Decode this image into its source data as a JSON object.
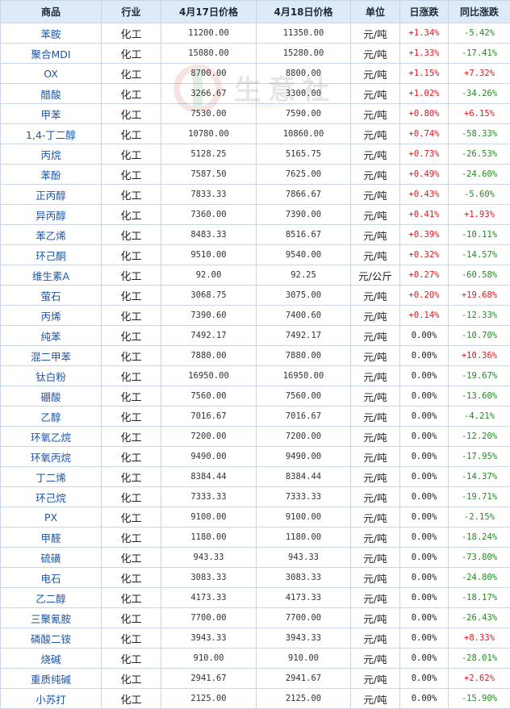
{
  "headers": [
    "商品",
    "行业",
    "4月17日价格",
    "4月18日价格",
    "单位",
    "日涨跌",
    "同比涨跌"
  ],
  "watermark": {
    "brand": "生意社",
    "site": "100ppi.com"
  },
  "colors": {
    "up": "#e0171f",
    "down": "#238a1f",
    "header_bg": "#dfeaf7",
    "link": "#1d55a8",
    "border": "#c7d5e6"
  },
  "rows": [
    {
      "name": "苯胺",
      "industry": "化工",
      "p1": "11200.00",
      "p2": "11350.00",
      "unit": "元/吨",
      "day": "+1.34%",
      "yoy": "-5.42%"
    },
    {
      "name": "聚合MDI",
      "industry": "化工",
      "p1": "15080.00",
      "p2": "15280.00",
      "unit": "元/吨",
      "day": "+1.33%",
      "yoy": "-17.41%"
    },
    {
      "name": "OX",
      "industry": "化工",
      "p1": "8700.00",
      "p2": "8800.00",
      "unit": "元/吨",
      "day": "+1.15%",
      "yoy": "+7.32%"
    },
    {
      "name": "醋酸",
      "industry": "化工",
      "p1": "3266.67",
      "p2": "3300.00",
      "unit": "元/吨",
      "day": "+1.02%",
      "yoy": "-34.26%"
    },
    {
      "name": "甲苯",
      "industry": "化工",
      "p1": "7530.00",
      "p2": "7590.00",
      "unit": "元/吨",
      "day": "+0.80%",
      "yoy": "+6.15%"
    },
    {
      "name": "1,4-丁二醇",
      "industry": "化工",
      "p1": "10780.00",
      "p2": "10860.00",
      "unit": "元/吨",
      "day": "+0.74%",
      "yoy": "-58.33%"
    },
    {
      "name": "丙烷",
      "industry": "化工",
      "p1": "5128.25",
      "p2": "5165.75",
      "unit": "元/吨",
      "day": "+0.73%",
      "yoy": "-26.53%"
    },
    {
      "name": "苯酚",
      "industry": "化工",
      "p1": "7587.50",
      "p2": "7625.00",
      "unit": "元/吨",
      "day": "+0.49%",
      "yoy": "-24.60%"
    },
    {
      "name": "正丙醇",
      "industry": "化工",
      "p1": "7833.33",
      "p2": "7866.67",
      "unit": "元/吨",
      "day": "+0.43%",
      "yoy": "-5.60%"
    },
    {
      "name": "异丙醇",
      "industry": "化工",
      "p1": "7360.00",
      "p2": "7390.00",
      "unit": "元/吨",
      "day": "+0.41%",
      "yoy": "+1.93%"
    },
    {
      "name": "苯乙烯",
      "industry": "化工",
      "p1": "8483.33",
      "p2": "8516.67",
      "unit": "元/吨",
      "day": "+0.39%",
      "yoy": "-10.11%"
    },
    {
      "name": "环己酮",
      "industry": "化工",
      "p1": "9510.00",
      "p2": "9540.00",
      "unit": "元/吨",
      "day": "+0.32%",
      "yoy": "-14.57%"
    },
    {
      "name": "维生素A",
      "industry": "化工",
      "p1": "92.00",
      "p2": "92.25",
      "unit": "元/公斤",
      "day": "+0.27%",
      "yoy": "-60.58%"
    },
    {
      "name": "萤石",
      "industry": "化工",
      "p1": "3068.75",
      "p2": "3075.00",
      "unit": "元/吨",
      "day": "+0.20%",
      "yoy": "+19.68%"
    },
    {
      "name": "丙烯",
      "industry": "化工",
      "p1": "7390.60",
      "p2": "7400.60",
      "unit": "元/吨",
      "day": "+0.14%",
      "yoy": "-12.33%"
    },
    {
      "name": "纯苯",
      "industry": "化工",
      "p1": "7492.17",
      "p2": "7492.17",
      "unit": "元/吨",
      "day": "0.00%",
      "yoy": "-10.70%"
    },
    {
      "name": "混二甲苯",
      "industry": "化工",
      "p1": "7880.00",
      "p2": "7880.00",
      "unit": "元/吨",
      "day": "0.00%",
      "yoy": "+10.36%"
    },
    {
      "name": "钛白粉",
      "industry": "化工",
      "p1": "16950.00",
      "p2": "16950.00",
      "unit": "元/吨",
      "day": "0.00%",
      "yoy": "-19.67%"
    },
    {
      "name": "硼酸",
      "industry": "化工",
      "p1": "7560.00",
      "p2": "7560.00",
      "unit": "元/吨",
      "day": "0.00%",
      "yoy": "-13.60%"
    },
    {
      "name": "乙醇",
      "industry": "化工",
      "p1": "7016.67",
      "p2": "7016.67",
      "unit": "元/吨",
      "day": "0.00%",
      "yoy": "-4.21%"
    },
    {
      "name": "环氧乙烷",
      "industry": "化工",
      "p1": "7200.00",
      "p2": "7200.00",
      "unit": "元/吨",
      "day": "0.00%",
      "yoy": "-12.20%"
    },
    {
      "name": "环氧丙烷",
      "industry": "化工",
      "p1": "9490.00",
      "p2": "9490.00",
      "unit": "元/吨",
      "day": "0.00%",
      "yoy": "-17.95%"
    },
    {
      "name": "丁二烯",
      "industry": "化工",
      "p1": "8384.44",
      "p2": "8384.44",
      "unit": "元/吨",
      "day": "0.00%",
      "yoy": "-14.37%"
    },
    {
      "name": "环己烷",
      "industry": "化工",
      "p1": "7333.33",
      "p2": "7333.33",
      "unit": "元/吨",
      "day": "0.00%",
      "yoy": "-19.71%"
    },
    {
      "name": "PX",
      "industry": "化工",
      "p1": "9100.00",
      "p2": "9100.00",
      "unit": "元/吨",
      "day": "0.00%",
      "yoy": "-2.15%"
    },
    {
      "name": "甲醛",
      "industry": "化工",
      "p1": "1180.00",
      "p2": "1180.00",
      "unit": "元/吨",
      "day": "0.00%",
      "yoy": "-18.24%"
    },
    {
      "name": "硫磺",
      "industry": "化工",
      "p1": "943.33",
      "p2": "943.33",
      "unit": "元/吨",
      "day": "0.00%",
      "yoy": "-73.80%"
    },
    {
      "name": "电石",
      "industry": "化工",
      "p1": "3083.33",
      "p2": "3083.33",
      "unit": "元/吨",
      "day": "0.00%",
      "yoy": "-24.80%"
    },
    {
      "name": "乙二醇",
      "industry": "化工",
      "p1": "4173.33",
      "p2": "4173.33",
      "unit": "元/吨",
      "day": "0.00%",
      "yoy": "-18.17%"
    },
    {
      "name": "三聚氰胺",
      "industry": "化工",
      "p1": "7700.00",
      "p2": "7700.00",
      "unit": "元/吨",
      "day": "0.00%",
      "yoy": "-26.43%"
    },
    {
      "name": "磷酸二铵",
      "industry": "化工",
      "p1": "3943.33",
      "p2": "3943.33",
      "unit": "元/吨",
      "day": "0.00%",
      "yoy": "+8.33%"
    },
    {
      "name": "烧碱",
      "industry": "化工",
      "p1": "910.00",
      "p2": "910.00",
      "unit": "元/吨",
      "day": "0.00%",
      "yoy": "-28.01%"
    },
    {
      "name": "重质纯碱",
      "industry": "化工",
      "p1": "2941.67",
      "p2": "2941.67",
      "unit": "元/吨",
      "day": "0.00%",
      "yoy": "+2.62%"
    },
    {
      "name": "小苏打",
      "industry": "化工",
      "p1": "2125.00",
      "p2": "2125.00",
      "unit": "元/吨",
      "day": "0.00%",
      "yoy": "-15.90%"
    }
  ]
}
